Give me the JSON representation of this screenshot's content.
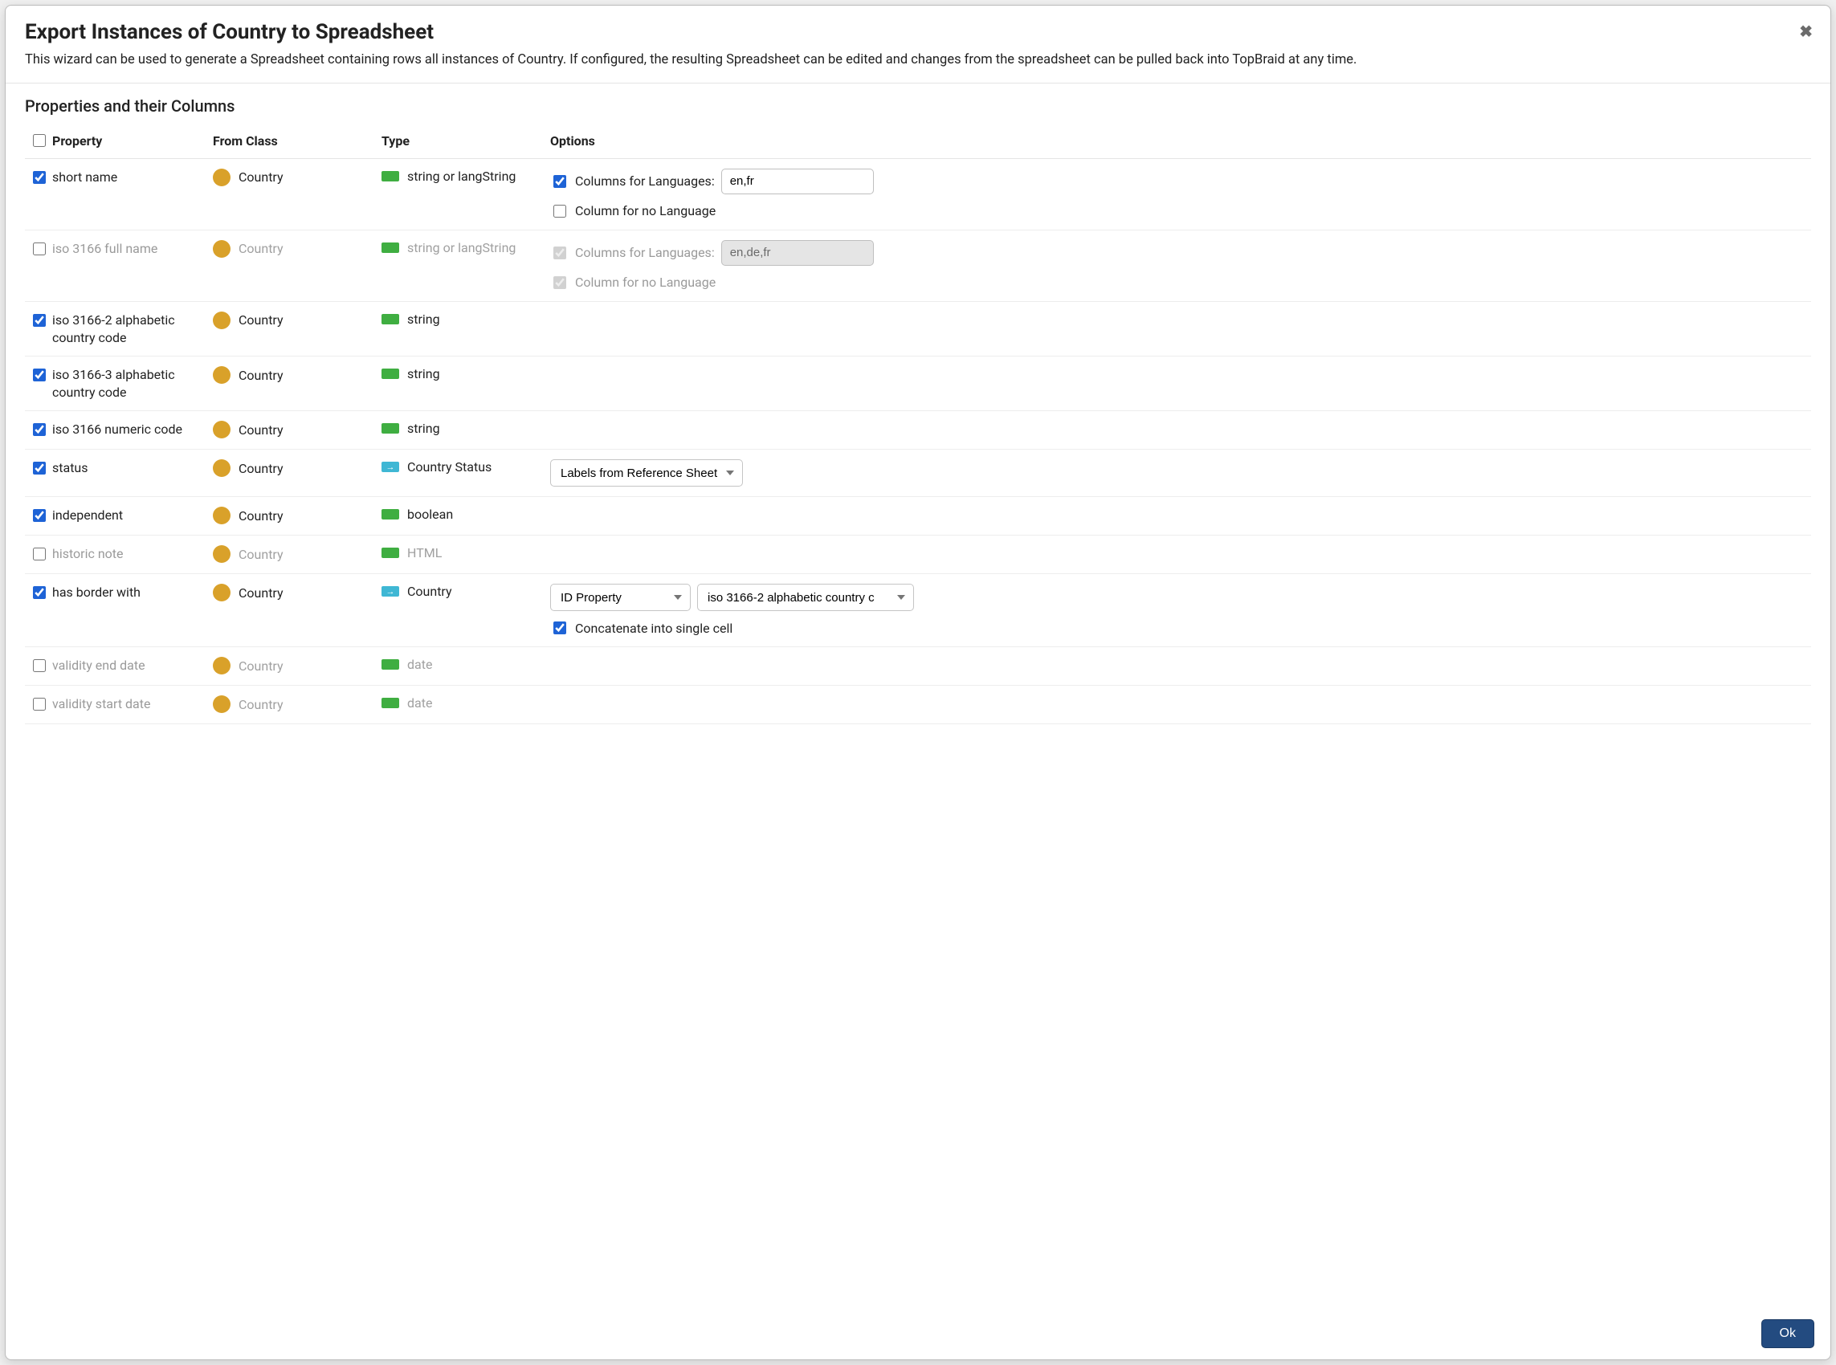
{
  "dialog": {
    "title": "Export Instances of Country to Spreadsheet",
    "description": "This wizard can be used to generate a Spreadsheet containing rows all instances of Country. If configured, the resulting Spreadsheet can be edited and changes from the spreadsheet can be pulled back into TopBraid at any time.",
    "section_heading": "Properties and their Columns",
    "ok_label": "Ok"
  },
  "columns": {
    "property": "Property",
    "from_class": "From Class",
    "type": "Type",
    "options": "Options"
  },
  "option_labels": {
    "columns_for_languages": "Columns for Languages:",
    "column_for_no_language": "Column for no Language",
    "concatenate": "Concatenate into single cell"
  },
  "rows": [
    {
      "checked": true,
      "property": "short name",
      "from_class": "Country",
      "type": "string or langString",
      "type_icon": "green",
      "options": {
        "kind": "lang",
        "columns_for_languages_checked": true,
        "languages_value": "en,fr",
        "column_no_lang_checked": false,
        "disabled": false
      }
    },
    {
      "checked": false,
      "property": "iso 3166 full name",
      "from_class": "Country",
      "type": "string or langString",
      "type_icon": "green",
      "options": {
        "kind": "lang",
        "columns_for_languages_checked": true,
        "languages_value": "en,de,fr",
        "column_no_lang_checked": true,
        "disabled": true
      }
    },
    {
      "checked": true,
      "property": "iso 3166-2 alphabetic country code",
      "from_class": "Country",
      "type": "string",
      "type_icon": "green",
      "options": {
        "kind": "none"
      }
    },
    {
      "checked": true,
      "property": "iso 3166-3 alphabetic country code",
      "from_class": "Country",
      "type": "string",
      "type_icon": "green",
      "options": {
        "kind": "none"
      }
    },
    {
      "checked": true,
      "property": "iso 3166 numeric code",
      "from_class": "Country",
      "type": "string",
      "type_icon": "green",
      "options": {
        "kind": "none"
      }
    },
    {
      "checked": true,
      "property": "status",
      "from_class": "Country",
      "type": "Country Status",
      "type_icon": "blue",
      "options": {
        "kind": "select_single",
        "select_value": "Labels from Reference Sheet"
      }
    },
    {
      "checked": true,
      "property": "independent",
      "from_class": "Country",
      "type": "boolean",
      "type_icon": "green",
      "options": {
        "kind": "none"
      }
    },
    {
      "checked": false,
      "property": "historic note",
      "from_class": "Country",
      "type": "HTML",
      "type_icon": "green",
      "options": {
        "kind": "none"
      }
    },
    {
      "checked": true,
      "property": "has border with",
      "from_class": "Country",
      "type": "Country",
      "type_icon": "blue",
      "options": {
        "kind": "ref",
        "select_a": "ID Property",
        "select_b": "iso 3166-2 alphabetic country c",
        "concat_checked": true
      }
    },
    {
      "checked": false,
      "property": "validity end date",
      "from_class": "Country",
      "type": "date",
      "type_icon": "green",
      "options": {
        "kind": "none"
      }
    },
    {
      "checked": false,
      "property": "validity start date",
      "from_class": "Country",
      "type": "date",
      "type_icon": "green",
      "options": {
        "kind": "none"
      }
    }
  ]
}
